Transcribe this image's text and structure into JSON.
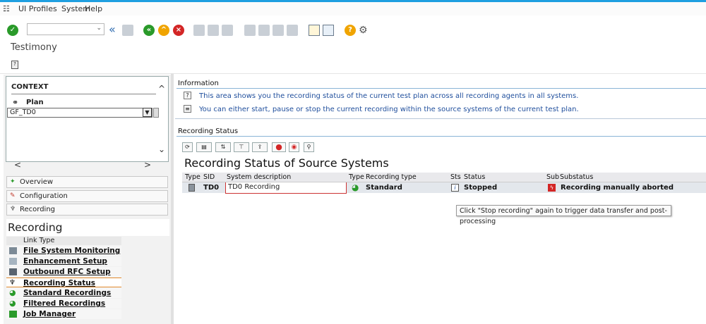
{
  "menu": [
    "UI Profiles",
    "System",
    "Help"
  ],
  "title": "Testimony",
  "context": {
    "title": "CONTEXT",
    "plan_label": "Plan",
    "plan_value": "GF_TD0"
  },
  "nav": [
    "Overview",
    "Configuration",
    "Recording"
  ],
  "recording_header": "Recording",
  "link_type_header": "Link Type",
  "links": [
    "File System Monitoring",
    "Enhancement Setup",
    "Outbound RFC Setup",
    "Recording Status",
    "Standard Recordings",
    "Filtered Recordings",
    "Job Manager"
  ],
  "information": {
    "label": "Information",
    "lines": [
      "This area shows you the recording status of the current test plan across all recording agents in all systems.",
      "You can either start, pause or stop the current recording within the source systems of the current test plan."
    ]
  },
  "recording_status": {
    "label": "Recording Status",
    "grid_title": "Recording Status of Source Systems",
    "columns": [
      "Type",
      "SID",
      "System description",
      "Type",
      "Recording type",
      "Sts",
      "Status",
      "Sub",
      "Substatus"
    ],
    "row": {
      "sid": "TD0",
      "system_description": "TD0 Recording",
      "recording_type": "Standard",
      "status": "Stopped",
      "substatus": "Recording manually aborted"
    }
  },
  "tooltip": "Click \"Stop recording\" again to trigger data transfer and post-processing",
  "colors": {
    "accent_blue": "#1f9fe0",
    "link_text": "#1f4e9c",
    "ok_green": "#2a9a2a",
    "error_red": "#d32626"
  }
}
